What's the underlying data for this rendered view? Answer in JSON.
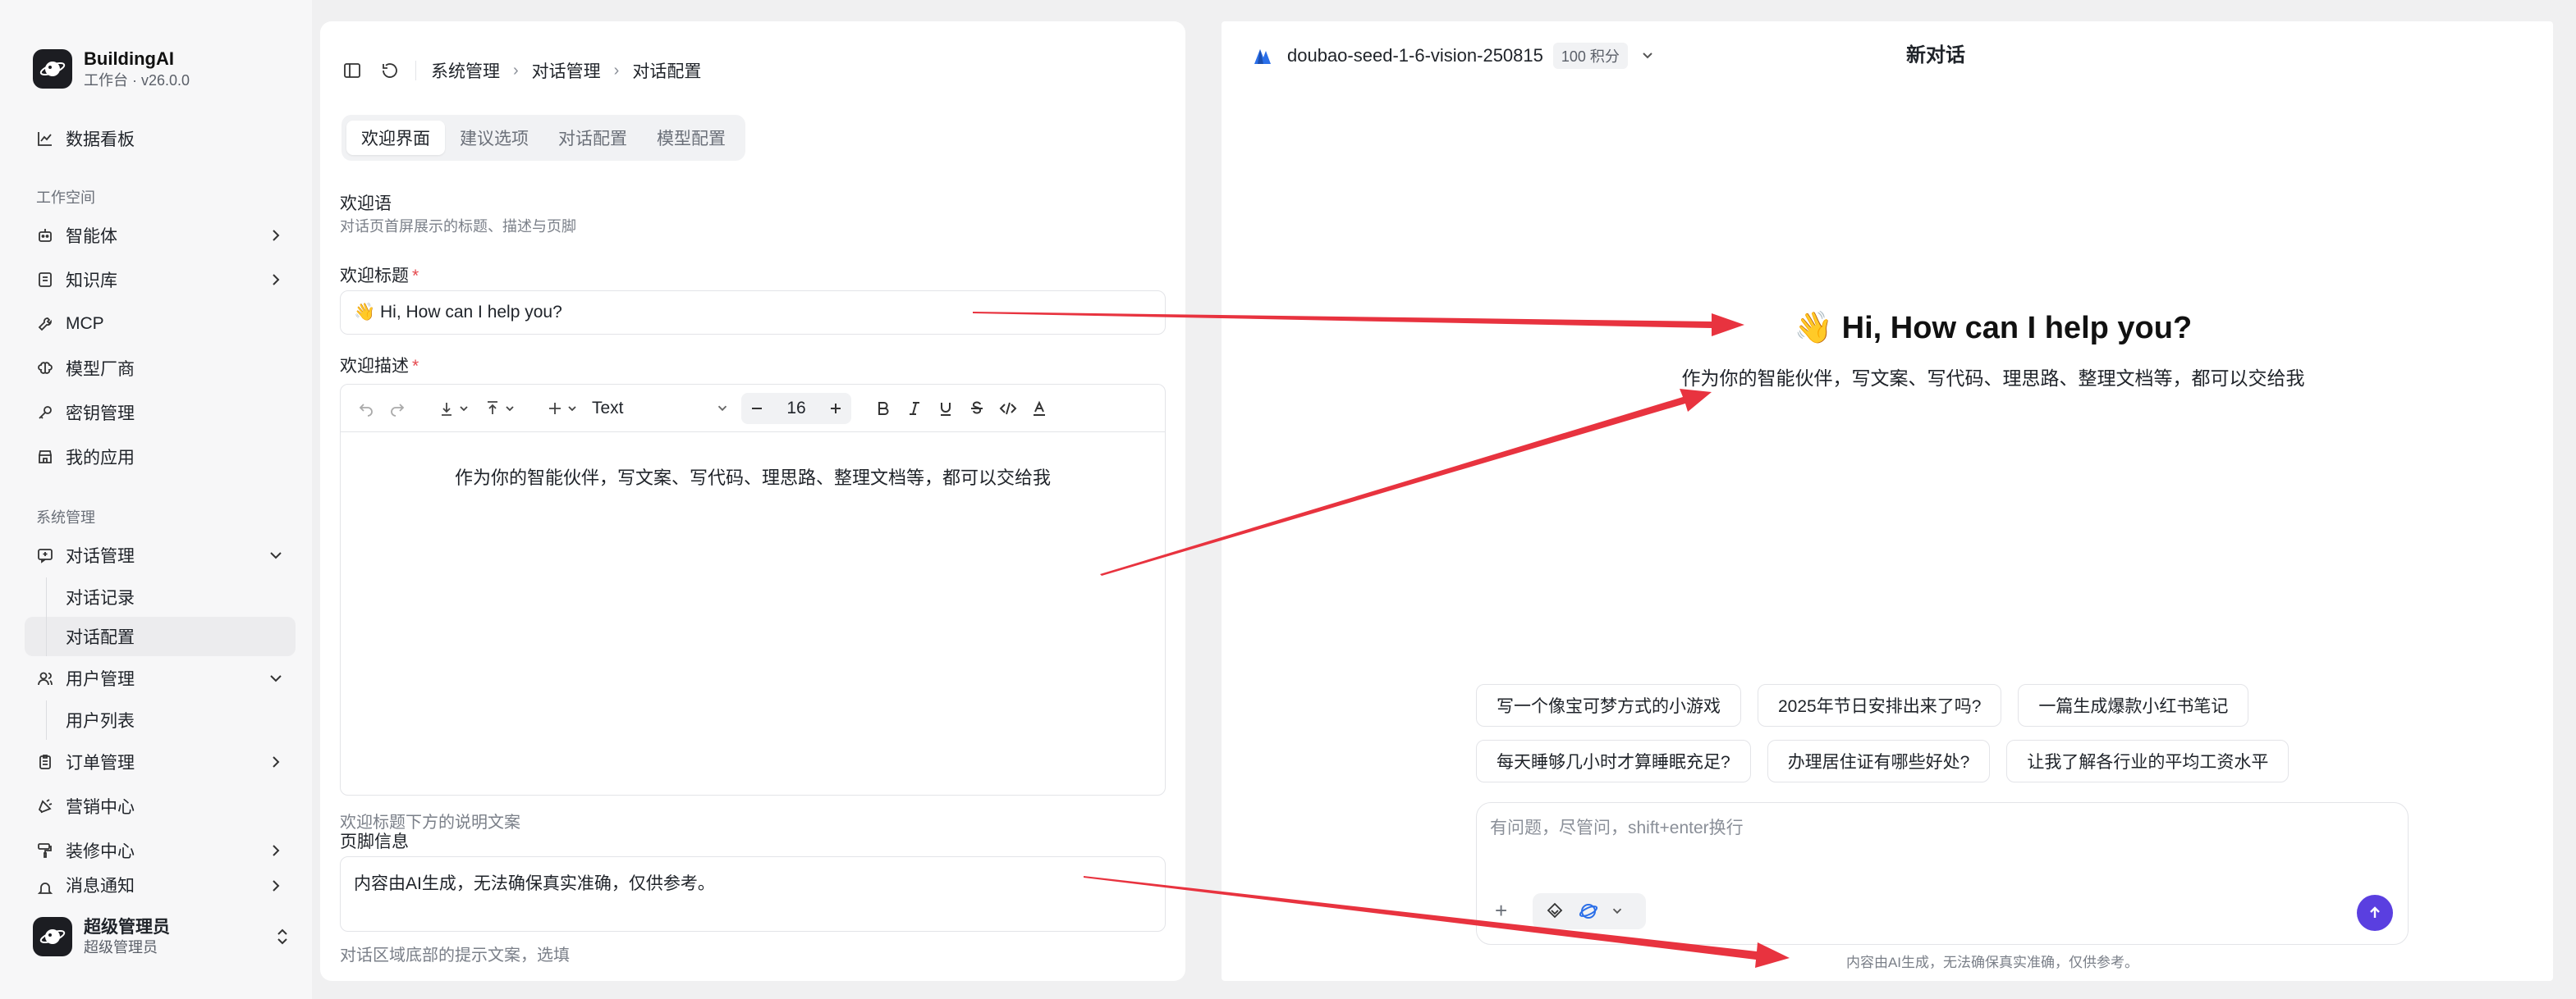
{
  "brand": {
    "name": "BuildingAI",
    "subtitle": "工作台 · v26.0.0"
  },
  "sidebar": {
    "dashboard": "数据看板",
    "workspace_section": "工作空间",
    "workspace_items": [
      {
        "label": "智能体",
        "icon": "robot-icon",
        "has_chevron": true
      },
      {
        "label": "知识库",
        "icon": "book-icon",
        "has_chevron": true
      },
      {
        "label": "MCP",
        "icon": "wrench-icon",
        "has_chevron": false
      },
      {
        "label": "模型厂商",
        "icon": "brain-icon",
        "has_chevron": false
      },
      {
        "label": "密钥管理",
        "icon": "key-icon",
        "has_chevron": false
      },
      {
        "label": "我的应用",
        "icon": "store-icon",
        "has_chevron": false
      }
    ],
    "system_section": "系统管理",
    "conversation_mgmt": "对话管理",
    "conversation_sub": [
      "对话记录",
      "对话配置"
    ],
    "user_mgmt": "用户管理",
    "user_sub": [
      "用户列表"
    ],
    "order_mgmt": "订单管理",
    "marketing": "营销中心",
    "decoration": "装修中心",
    "notifications": "消息通知"
  },
  "user": {
    "name": "超级管理员",
    "role": "超级管理员"
  },
  "breadcrumb": [
    "系统管理",
    "对话管理",
    "对话配置"
  ],
  "tabs": [
    {
      "label": "欢迎界面",
      "active": true
    },
    {
      "label": "建议选项",
      "active": false
    },
    {
      "label": "对话配置",
      "active": false
    },
    {
      "label": "模型配置",
      "active": false
    }
  ],
  "form": {
    "section_title": "欢迎语",
    "section_desc": "对话页首屏展示的标题、描述与页脚",
    "title_label": "欢迎标题",
    "title_value": "👋 Hi, How can I help you?",
    "desc_label": "欢迎描述",
    "editor": {
      "block_type": "Text",
      "font_size": "16"
    },
    "desc_value": "作为你的智能伙伴，写文案、写代码、理思路、整理文档等，都可以交给我",
    "desc_hint": "欢迎标题下方的说明文案",
    "footer_label": "页脚信息",
    "footer_value": "内容由AI生成，无法确保真实准确，仅供参考。",
    "footer_hint": "对话区域底部的提示文案，选填"
  },
  "preview": {
    "model_name": "doubao-seed-1-6-vision-250815",
    "credits": "100 积分",
    "chat_title": "新对话",
    "welcome_title": "👋 Hi, How can I help you?",
    "welcome_desc": "作为你的智能伙伴，写文案、写代码、理思路、整理文档等，都可以交给我",
    "suggestions_row1": [
      "写一个像宝可梦方式的小游戏",
      "2025年节日安排出来了吗?",
      "一篇生成爆款小红书笔记"
    ],
    "suggestions_row2": [
      "每天睡够几小时才算睡眠充足?",
      "办理居住证有哪些好处?",
      "让我了解各行业的平均工资水平"
    ],
    "input_placeholder": "有问题，尽管问，shift+enter换行",
    "footnote": "内容由AI生成，无法确保真实准确，仅供参考。"
  },
  "colors": {
    "accent": "#5a3fe0",
    "arrow": "#e8333f",
    "required": "#e5484d"
  }
}
